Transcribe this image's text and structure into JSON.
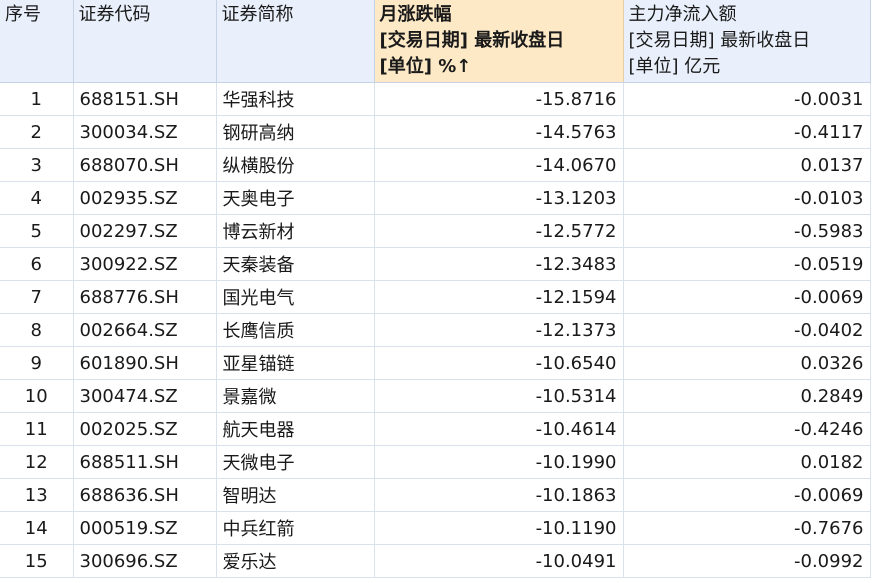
{
  "header": {
    "idx": "序号",
    "code": "证券代码",
    "name": "证券简称",
    "change": [
      "月涨跌幅",
      "[交易日期] 最新收盘日",
      "[单位] %↑"
    ],
    "flow": [
      "主力净流入额",
      "[交易日期] 最新收盘日",
      "[单位] 亿元"
    ]
  },
  "rows": [
    {
      "idx": "1",
      "code": "688151.SH",
      "name": "华强科技",
      "change": "-15.8716",
      "flow": "-0.0031"
    },
    {
      "idx": "2",
      "code": "300034.SZ",
      "name": "钢研高纳",
      "change": "-14.5763",
      "flow": "-0.4117"
    },
    {
      "idx": "3",
      "code": "688070.SH",
      "name": "纵横股份",
      "change": "-14.0670",
      "flow": "0.0137"
    },
    {
      "idx": "4",
      "code": "002935.SZ",
      "name": "天奥电子",
      "change": "-13.1203",
      "flow": "-0.0103"
    },
    {
      "idx": "5",
      "code": "002297.SZ",
      "name": "博云新材",
      "change": "-12.5772",
      "flow": "-0.5983"
    },
    {
      "idx": "6",
      "code": "300922.SZ",
      "name": "天秦装备",
      "change": "-12.3483",
      "flow": "-0.0519"
    },
    {
      "idx": "7",
      "code": "688776.SH",
      "name": "国光电气",
      "change": "-12.1594",
      "flow": "-0.0069"
    },
    {
      "idx": "8",
      "code": "002664.SZ",
      "name": "长鹰信质",
      "change": "-12.1373",
      "flow": "-0.0402"
    },
    {
      "idx": "9",
      "code": "601890.SH",
      "name": "亚星锚链",
      "change": "-10.6540",
      "flow": "0.0326"
    },
    {
      "idx": "10",
      "code": "300474.SZ",
      "name": "景嘉微",
      "change": "-10.5314",
      "flow": "0.2849"
    },
    {
      "idx": "11",
      "code": "002025.SZ",
      "name": "航天电器",
      "change": "-10.4614",
      "flow": "-0.4246"
    },
    {
      "idx": "12",
      "code": "688511.SH",
      "name": "天微电子",
      "change": "-10.1990",
      "flow": "0.0182"
    },
    {
      "idx": "13",
      "code": "688636.SH",
      "name": "智明达",
      "change": "-10.1863",
      "flow": "-0.0069"
    },
    {
      "idx": "14",
      "code": "000519.SZ",
      "name": "中兵红箭",
      "change": "-10.1190",
      "flow": "-0.7676"
    },
    {
      "idx": "15",
      "code": "300696.SZ",
      "name": "爱乐达",
      "change": "-10.0491",
      "flow": "-0.0992"
    }
  ]
}
